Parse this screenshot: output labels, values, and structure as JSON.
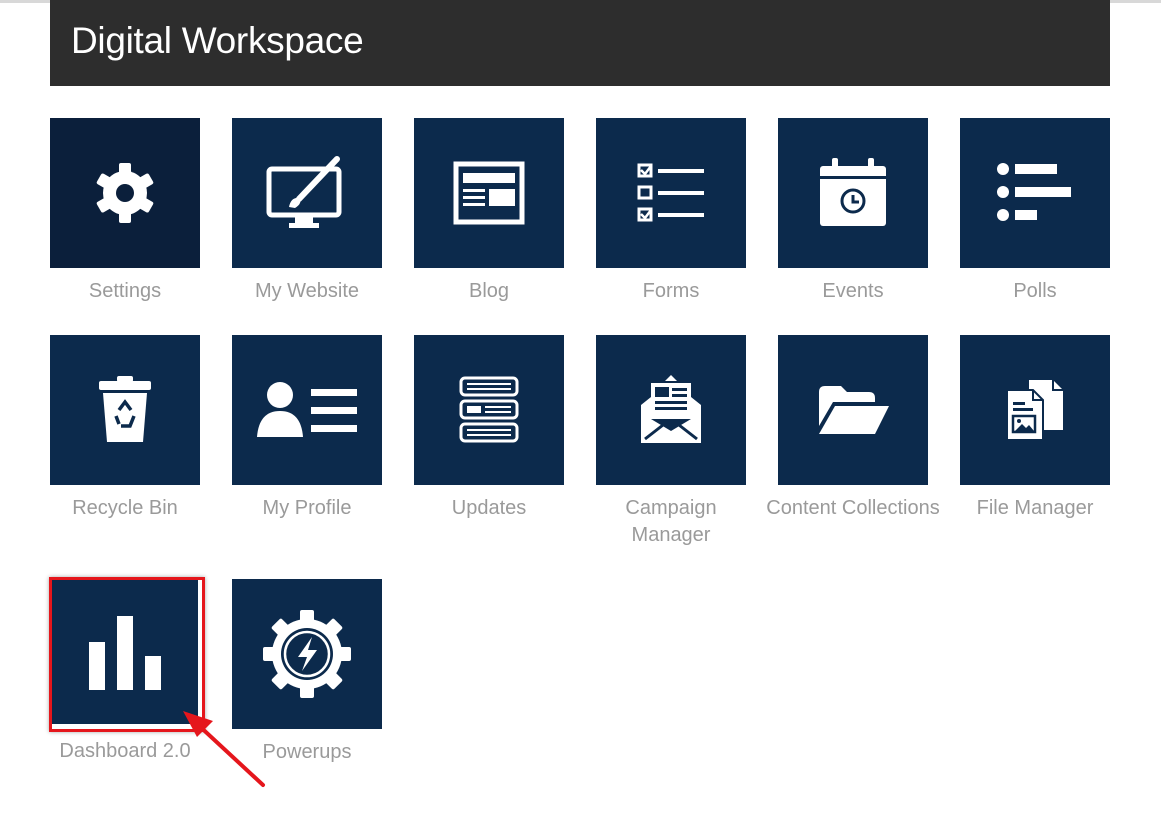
{
  "header": {
    "title": "Digital Workspace"
  },
  "tiles": [
    {
      "label": "Settings",
      "icon": "gear-icon"
    },
    {
      "label": "My Website",
      "icon": "monitor-brush-icon"
    },
    {
      "label": "Blog",
      "icon": "newspaper-icon"
    },
    {
      "label": "Forms",
      "icon": "checklist-icon"
    },
    {
      "label": "Events",
      "icon": "calendar-clock-icon"
    },
    {
      "label": "Polls",
      "icon": "poll-bars-icon"
    },
    {
      "label": "Recycle Bin",
      "icon": "recycle-bin-icon"
    },
    {
      "label": "My Profile",
      "icon": "profile-card-icon"
    },
    {
      "label": "Updates",
      "icon": "stacked-updates-icon"
    },
    {
      "label": "Campaign Manager",
      "icon": "envelope-newsletter-icon"
    },
    {
      "label": "Content Collections",
      "icon": "open-folder-icon"
    },
    {
      "label": "File Manager",
      "icon": "files-icon"
    },
    {
      "label": "Dashboard 2.0",
      "icon": "bar-chart-icon"
    },
    {
      "label": "Powerups",
      "icon": "lightning-gear-icon"
    }
  ],
  "annotation": {
    "highlighted_tile": "Dashboard 2.0",
    "highlight_color": "#e5161c"
  },
  "colors": {
    "tile_background": "#0c2a4c",
    "header_background": "#2d2d2d",
    "label_text": "#9a9a9a"
  }
}
